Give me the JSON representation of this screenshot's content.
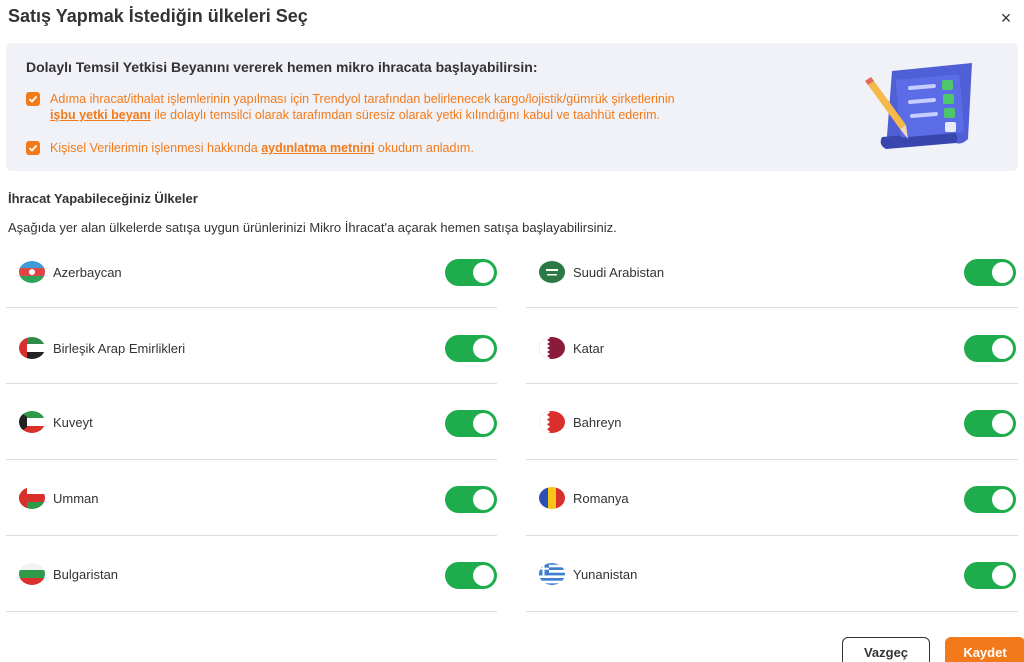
{
  "header": {
    "title": "Satış Yapmak İstediğin ülkeleri Seç",
    "close_icon": "×"
  },
  "info": {
    "title": "Dolaylı Temsil Yetkisi Beyanını vererek hemen mikro ihracata başlayabilirsin:",
    "consent1_line1": "Adıma ihracat/ithalat işlemlerinin yapılması için Trendyol tarafından belirlenecek kargo/lojistik/gümrük şirketlerinin",
    "consent1_link": "işbu yetki beyanı",
    "consent1_rest": " ile dolaylı temsilci olarak tarafımdan süresiz olarak yetki kılındığını kabul ve taahhüt ederim.",
    "consent2_pre": "Kişisel Verilerimin işlenmesi hakkında ",
    "consent2_link": "aydınlatma metnini",
    "consent2_post": " okudum anladım.",
    "accent": "#f27a1a"
  },
  "countries_section": {
    "title": "İhracat Yapabileceğiniz Ülkeler",
    "description": "Aşağıda yer alan ülkelerde satışa uygun ürünlerinizi Mikro İhracat'a açarak hemen satışa başlayabilirsiniz.",
    "left": [
      {
        "name": "Azerbaycan",
        "flag": "azerbaijan-flag-icon",
        "enabled": true
      },
      {
        "name": "Birleşik Arap Emirlikleri",
        "flag": "uae-flag-icon",
        "enabled": true
      },
      {
        "name": "Kuveyt",
        "flag": "kuwait-flag-icon",
        "enabled": true
      },
      {
        "name": "Umman",
        "flag": "oman-flag-icon",
        "enabled": true
      },
      {
        "name": "Bulgaristan",
        "flag": "bulgaria-flag-icon",
        "enabled": true
      }
    ],
    "right": [
      {
        "name": "Suudi Arabistan",
        "flag": "saudi-flag-icon",
        "enabled": true
      },
      {
        "name": "Katar",
        "flag": "qatar-flag-icon",
        "enabled": true
      },
      {
        "name": "Bahreyn",
        "flag": "bahrain-flag-icon",
        "enabled": true
      },
      {
        "name": "Romanya",
        "flag": "romania-flag-icon",
        "enabled": true
      },
      {
        "name": "Yunanistan",
        "flag": "greece-flag-icon",
        "enabled": true
      }
    ],
    "toggle_color": "#1fac4d"
  },
  "footer": {
    "cancel_label": "Vazgeç",
    "save_label": "Kaydet"
  }
}
